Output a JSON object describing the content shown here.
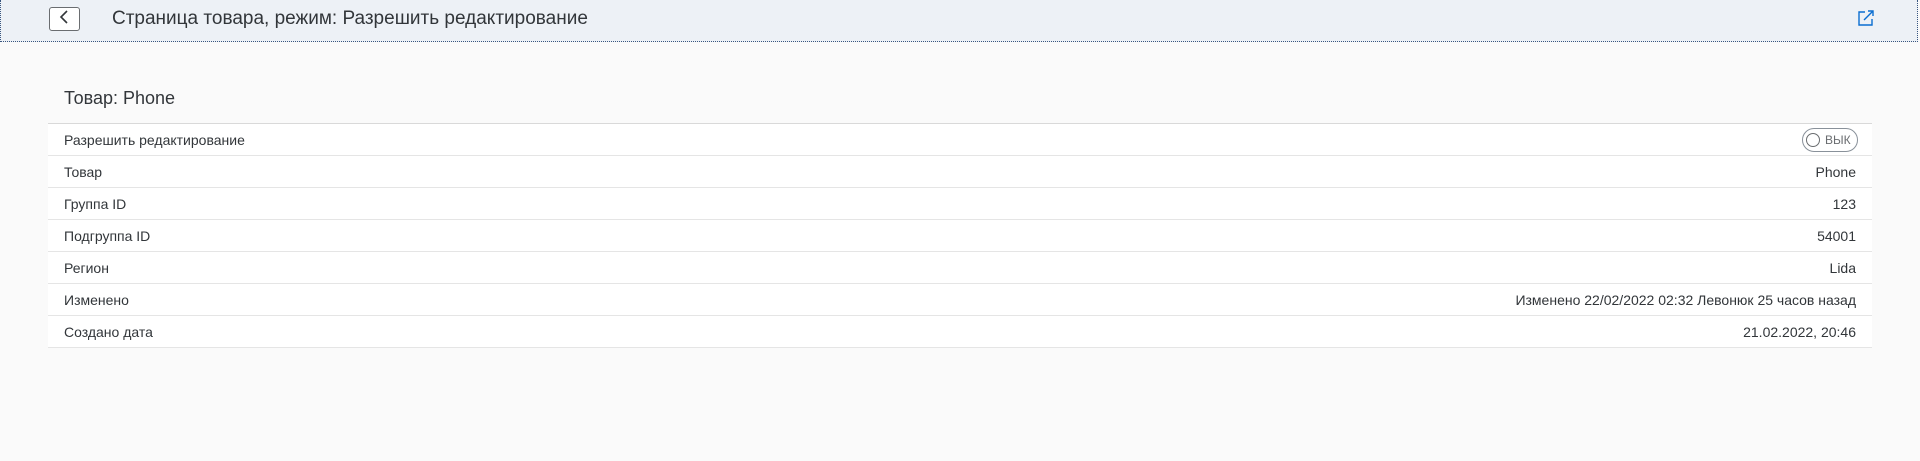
{
  "header": {
    "title": "Страница товара, режим: Разрешить редактирование",
    "back_icon": "chevron-left-icon",
    "share_icon": "share-icon"
  },
  "object": {
    "title": "Товар: Phone"
  },
  "form": {
    "toggle": {
      "label": "Разрешить редактирование",
      "state_text": "ВЫК"
    },
    "rows": [
      {
        "label": "Товар",
        "value": "Phone"
      },
      {
        "label": "Группа ID",
        "value": "123"
      },
      {
        "label": "Подгруппа ID",
        "value": "54001"
      },
      {
        "label": "Регион",
        "value": "Lida"
      },
      {
        "label": "Изменено",
        "value": "Изменено 22/02/2022 02:32 Левонюк 25 часов назад"
      },
      {
        "label": "Создано дата",
        "value": "21.02.2022, 20:46"
      }
    ]
  },
  "colors": {
    "header_bg": "#edf1f6",
    "header_border": "#39567f",
    "accent": "#0a6ed1"
  }
}
